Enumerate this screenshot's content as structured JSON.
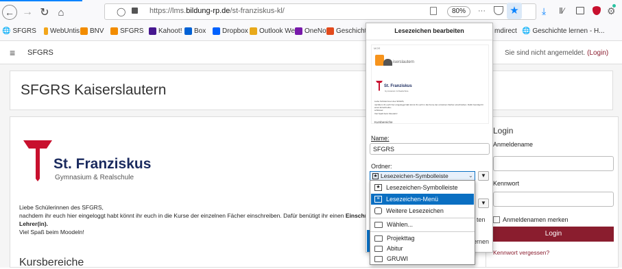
{
  "browser": {
    "url_prefix": "https://lms.",
    "url_domain": "bildung-rp.de",
    "url_path": "/st-franziskus-kl/",
    "zoom": "80%",
    "more": "···"
  },
  "bookmarks": [
    {
      "label": "SFGRS",
      "color": "#555"
    },
    {
      "label": "WebUntis",
      "color": "#f2a51a"
    },
    {
      "label": "BNV",
      "color": "#f28c00"
    },
    {
      "label": "SFGRS",
      "color": "#f28c00"
    },
    {
      "label": "Kahoot!",
      "color": "#46178f"
    },
    {
      "label": "Box",
      "color": "#0061d5"
    },
    {
      "label": "Dropbox",
      "color": "#0061fe"
    },
    {
      "label": "Outlook Web",
      "color": "#e8a91b"
    },
    {
      "label": "OneNote",
      "color": "#7719aa"
    },
    {
      "label": "Geschichte Lernen",
      "color": "#e24a1c"
    }
  ],
  "bookmarks_right": {
    "item1": "mdirect",
    "item2": "Geschichte lernen - H..."
  },
  "site": {
    "menu_icon": "≡",
    "name": "SFGRS",
    "login_status": "Sie sind nicht angemeldet.",
    "login_link": "(Login)",
    "page_title": "SFGRS Kaiserslautern"
  },
  "logo": {
    "title": "St. Franziskus",
    "subtitle": "Gymnasium & Realschule"
  },
  "content": {
    "line1": "Liebe Schülerinnen des SFGRS,",
    "line2": "nachdem ihr euch hier eingeloggt habt könnt ihr euch in die Kurse der einzelnen Fächer einschreiben. Dafür benütigt ihr einen",
    "line2_bold": "Einschreibeschlü",
    "line3": "Lehrer(in).",
    "line4": "Viel Spaß beim Moodeln!",
    "section_heading": "Kursbereiche"
  },
  "login": {
    "title": "Login",
    "username_label": "Anmeldename",
    "password_label": "Kennwort",
    "remember_label": "Anmeldenamen merken",
    "button": "Login",
    "forgot": "Kennwort vergessen?"
  },
  "popup": {
    "title": "Lesezeichen bearbeiten",
    "preview_header": "MOR",
    "preview_site": "iserslautern",
    "preview_logo": "St. Franziskus",
    "preview_logo_sub": "Gymnasium & Realschule",
    "preview_line1": "Liebe Schülerinnen des SFGRS,",
    "preview_line2": "nachdem ihr euch hier eingeloggt habt könnt ihr euch in die Kurse der einzelnen Fächer einschreiben. Dafür benütigt ihr einen Einschreibe-",
    "preview_line3": "schlüssel",
    "preview_line4": "Viel Spaß beim Moodeln!",
    "preview_kurs": "Kursbereiche",
    "name_label": "Name:",
    "name_value": "SFGRS",
    "folder_label": "Ordner:",
    "folder_value": "Lesezeichen-Symbolleiste",
    "behind_right": "ten",
    "behind_btn": "ernen"
  },
  "dropdown": [
    {
      "label": "Lesezeichen-Symbolleiste",
      "icon": "star-folder-icon",
      "selected": false
    },
    {
      "label": "Lesezeichen-Menü",
      "icon": "menu-folder-icon",
      "selected": true
    },
    {
      "label": "Weitere Lesezeichen",
      "icon": "other-folder-icon",
      "selected": false
    },
    {
      "label": "Wählen...",
      "icon": "folder-icon",
      "selected": false
    },
    {
      "label": "Projekttag",
      "icon": "folder-icon",
      "selected": false
    },
    {
      "label": "Abitur",
      "icon": "folder-icon",
      "selected": false
    },
    {
      "label": "GRUWI",
      "icon": "folder-icon",
      "selected": false
    }
  ],
  "colors": {
    "accent": "#0a84ff",
    "brand": "#c8102e",
    "wine": "#8a1d2e",
    "selection": "#0a6fc2"
  }
}
